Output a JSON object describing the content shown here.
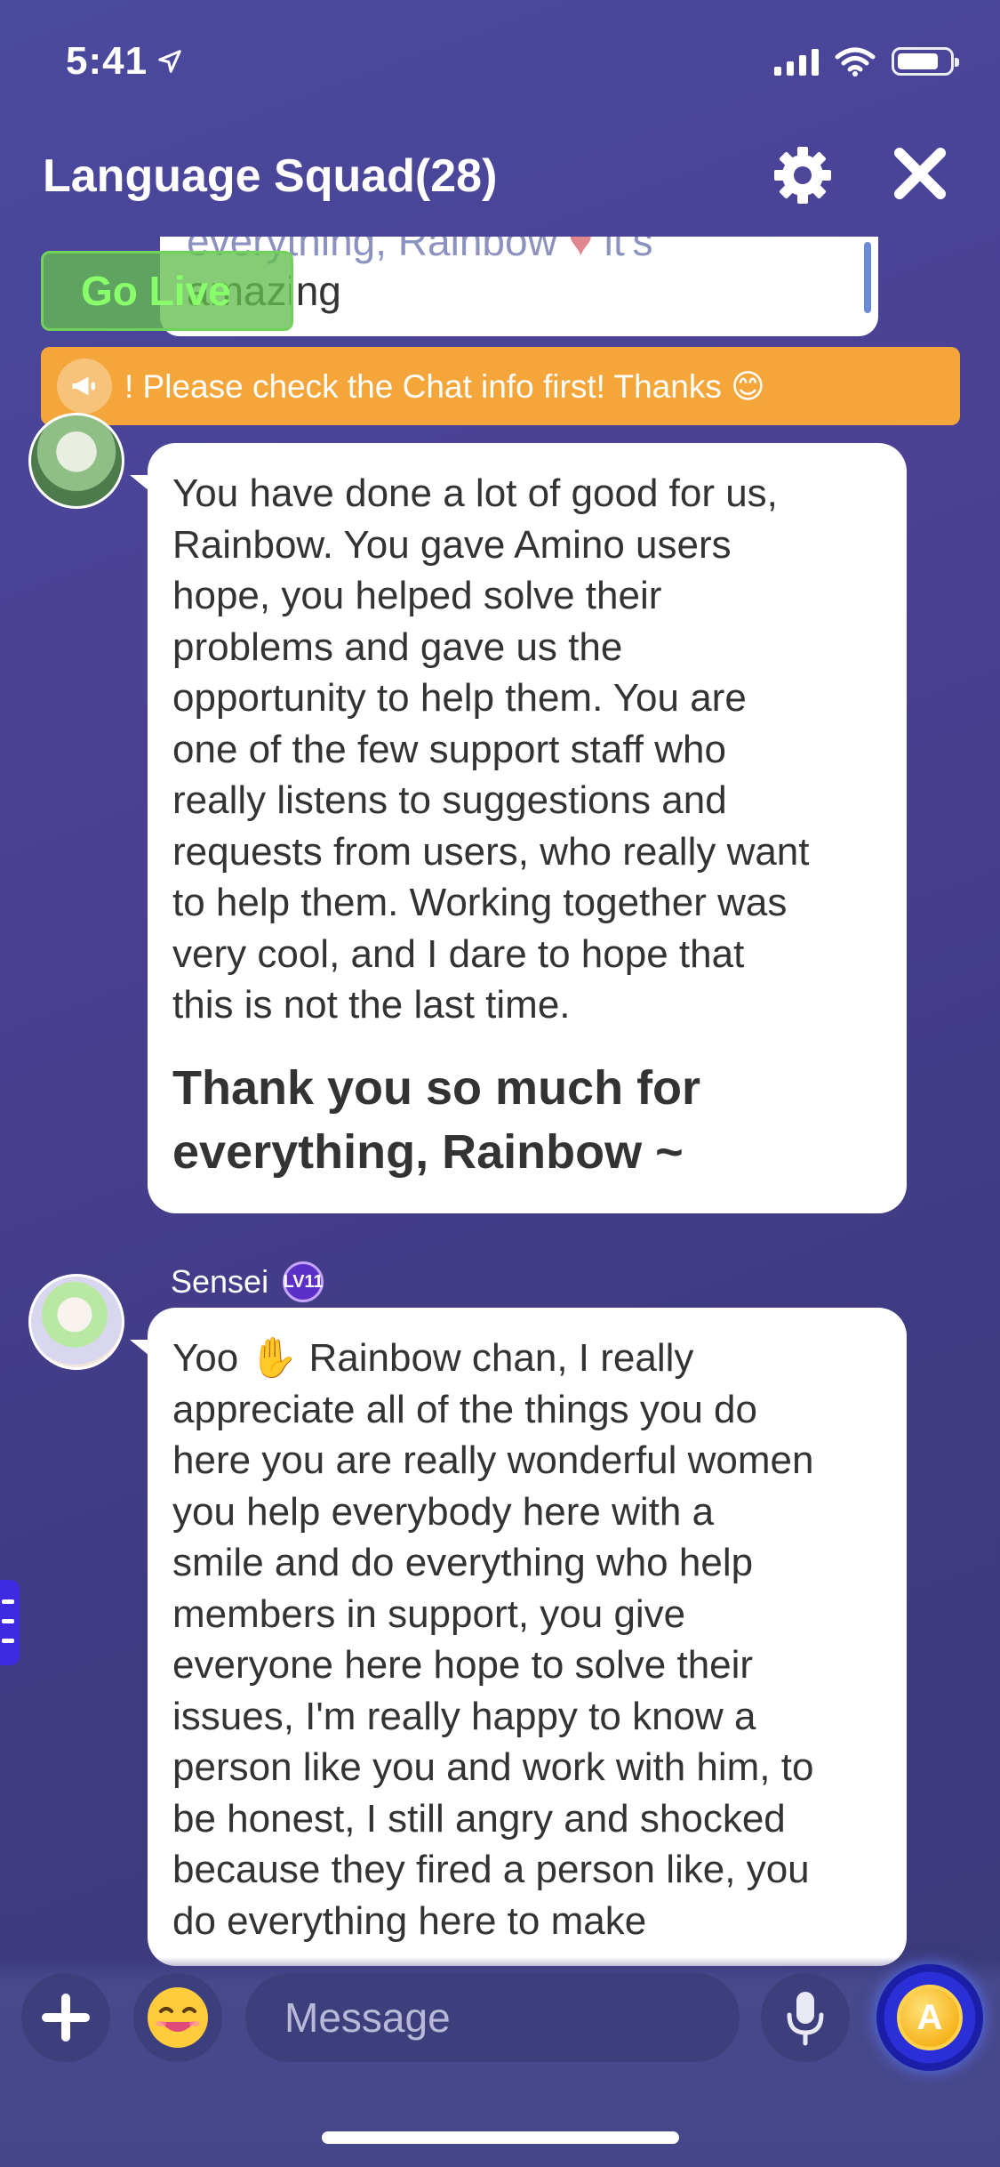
{
  "status_bar": {
    "time": "5:41"
  },
  "header": {
    "title": "Language Squad(28)"
  },
  "previous_message": {
    "line1": "everything, Rainbow",
    "line1_tail": "it's",
    "line2": "amazing"
  },
  "go_live": {
    "label": "Go Live"
  },
  "announcement": {
    "text": "! Please check the Chat info first! Thanks 😊"
  },
  "messages": [
    {
      "user": "",
      "text": "You have done a lot of good for us,\nRainbow. You gave Amino users\nhope, you helped solve their\nproblems and gave us the\nopportunity to help them. You are\none of the few support staff who\nreally listens to suggestions and\nrequests from users, who really want\nto help them. Working together was\nvery cool, and I dare to hope that\nthis is not the last time.",
      "bold_text": "Thank you so much for\neverything, Rainbow ~"
    },
    {
      "user": "Sensei",
      "level": "LV11",
      "text": "Yoo ✋ Rainbow chan, I really\nappreciate all of the things you do\nhere you are really wonderful women\nyou help everybody here with a\nsmile and do everything who help\nmembers in support, you give\neveryone here hope to solve their\nissues, I'm really happy to know a\nperson like you and work with him, to\nbe honest, I still angry and shocked\nbecause they fired a person like, you\ndo everything here to make"
    }
  ],
  "composer": {
    "placeholder": "Message"
  },
  "colors": {
    "accent_orange": "#f4a63a",
    "go_live_green": "#88ff6a",
    "background": "#4b3f93"
  },
  "icons": [
    "location-arrow-icon",
    "signal-icon",
    "wifi-icon",
    "battery-icon",
    "gear-icon",
    "close-icon",
    "megaphone-icon",
    "plus-icon",
    "emoji-icon",
    "microphone-icon",
    "coin-icon",
    "menu-handle-icon"
  ]
}
